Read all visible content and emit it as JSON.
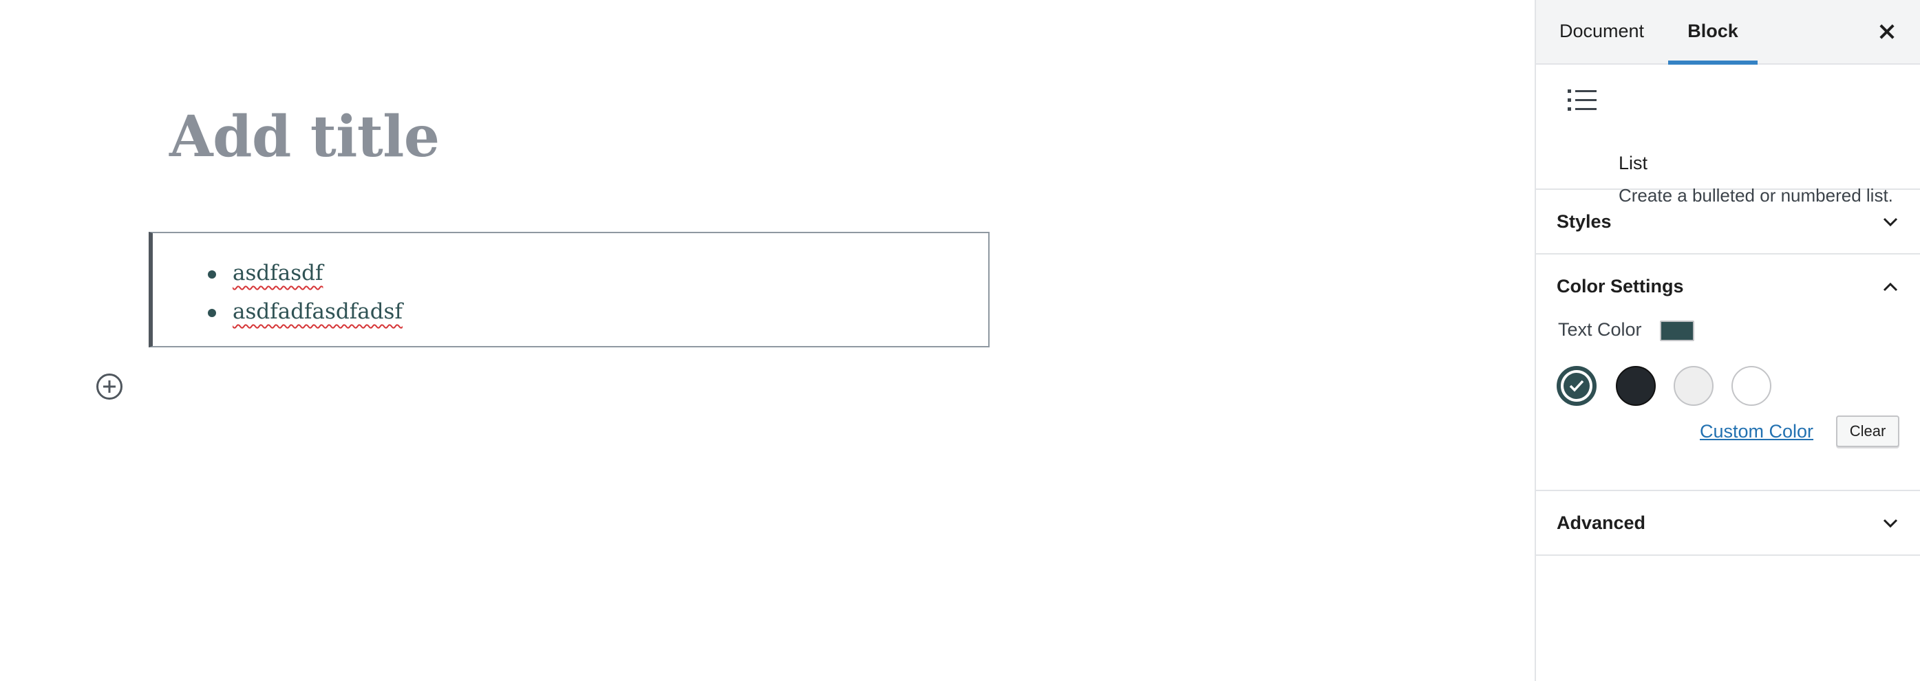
{
  "editor": {
    "title_placeholder": "Add title",
    "list_items": [
      "asdfasdf",
      "asdfadfasdfadsf"
    ],
    "list_text_color": "#2f5254"
  },
  "sidebar": {
    "tabs": [
      {
        "label": "Document",
        "active": false
      },
      {
        "label": "Block",
        "active": true
      }
    ],
    "close_icon": "close-icon",
    "block_card": {
      "icon": "list-icon",
      "title": "List",
      "description": "Create a bulleted or numbered list."
    },
    "panels": {
      "styles": {
        "title": "Styles",
        "expanded": false
      },
      "color_settings": {
        "title": "Color Settings",
        "expanded": true,
        "text_color_label": "Text Color",
        "selected_color": "#2f4f52",
        "palette": [
          {
            "color": "#2f4f52",
            "selected": true
          },
          {
            "color": "#23282d",
            "selected": false
          },
          {
            "color": "#eeeeee",
            "selected": false
          },
          {
            "color": "#ffffff",
            "selected": false
          }
        ],
        "custom_color_label": "Custom Color",
        "clear_label": "Clear"
      },
      "advanced": {
        "title": "Advanced",
        "expanded": false
      }
    }
  },
  "colors": {
    "accent": "#3582c4",
    "link": "#2271b1",
    "title_placeholder": "#8a9099"
  }
}
